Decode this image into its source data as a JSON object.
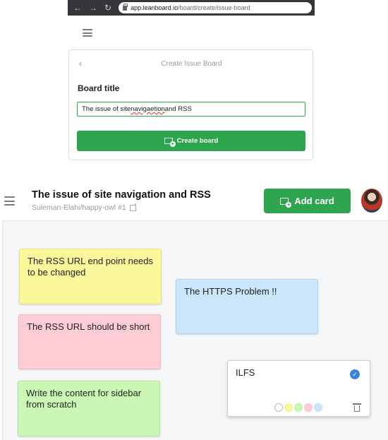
{
  "browser": {
    "url_host": "app.leanboard.io",
    "url_path": "/board/create/issue-board",
    "icons": [
      "back-arrow-icon",
      "forward-arrow-icon",
      "reload-icon",
      "lock-icon"
    ]
  },
  "create_panel": {
    "title": "Create Issue Board",
    "board_title_label": "Board title",
    "board_title_value_pre": "The issue of site ",
    "board_title_value_misspelled": "navigaetion",
    "board_title_value_post": " and RSS",
    "create_button_label": "Create board",
    "icons": [
      "chevron-left-icon",
      "add-card-icon"
    ]
  },
  "board": {
    "title": "The issue of site navigation and RSS",
    "subtitle": "Suleman-Elahi/happy-owl #1",
    "add_card_label": "Add card",
    "icons": [
      "hamburger-menu-icon",
      "external-link-icon",
      "add-card-icon",
      "avatar"
    ]
  },
  "notes": [
    {
      "text": "The RSS URL end point needs to be changed",
      "color": "#faf79a"
    },
    {
      "text": "The RSS URL should be short",
      "color": "#ffccd5"
    },
    {
      "text": "Write the content for sidebar from scratch",
      "color": "#caf7b4"
    },
    {
      "text": "The HTTPS Problem !!",
      "color": "#c9e6fd"
    },
    {
      "text": "ILFS",
      "color": "#ffffff"
    }
  ],
  "color_options": [
    "#ffffff",
    "#faf79a",
    "#caf7b4",
    "#ffccd5",
    "#c9e6fd"
  ],
  "colors": {
    "accent_green": "#2da44e",
    "check_blue": "#3b82d9"
  }
}
